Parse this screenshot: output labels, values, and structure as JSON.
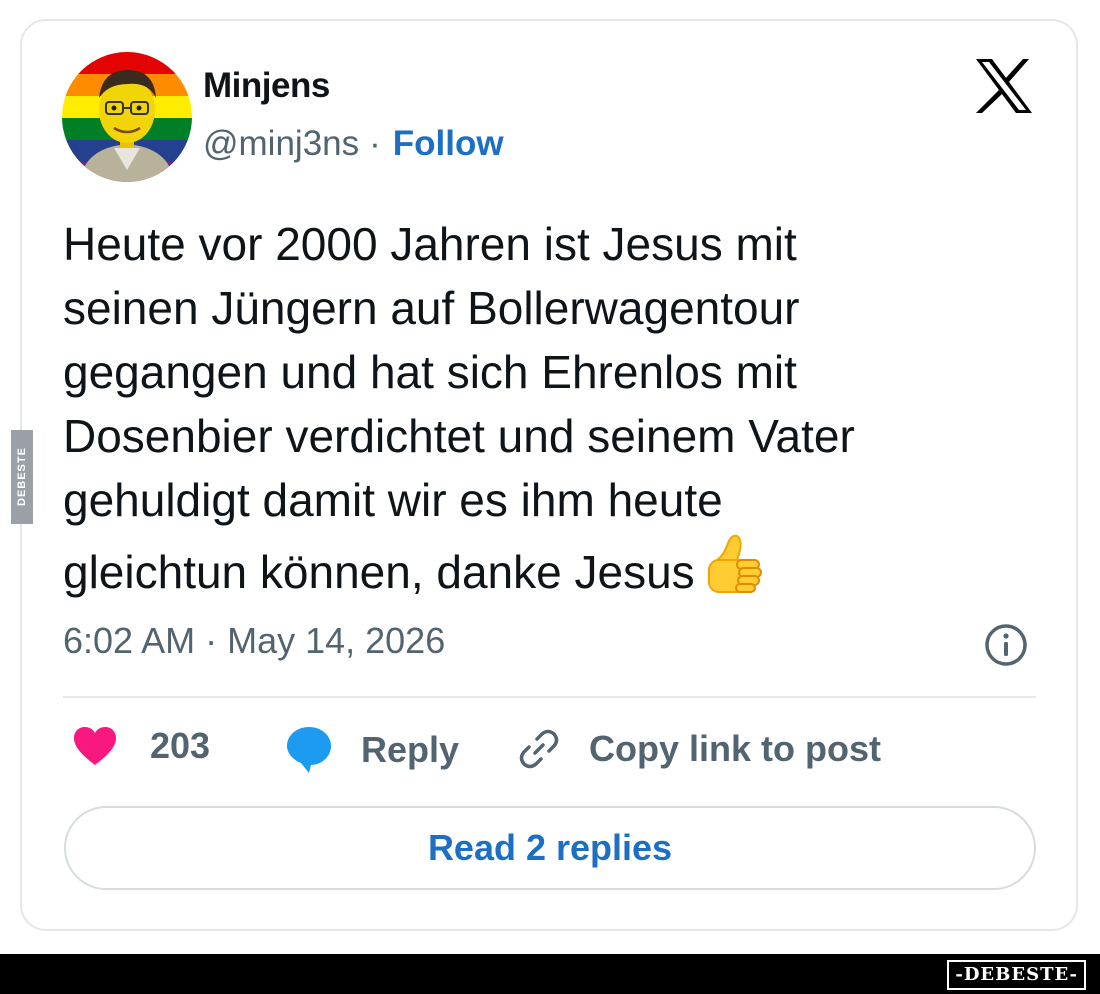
{
  "author": {
    "display_name": "Minjens",
    "handle": "@minj3ns",
    "separator": "·",
    "follow_label": "Follow"
  },
  "platform": {
    "logo_icon": "x-logo-icon"
  },
  "tweet": {
    "lines": [
      "Heute vor 2000 Jahren ist Jesus mit",
      "seinen Jüngern auf Bollerwagentour",
      "gegangen und hat sich Ehrenlos mit",
      "Dosenbier verdichtet und seinem Vater",
      "gehuldigt damit wir es ihm heute",
      "gleichtun können, danke Jesus"
    ],
    "emoji_icon": "thumbs-up-icon",
    "timestamp": "6:02 AM · May 14, 2026"
  },
  "actions": {
    "like_count": "203",
    "reply_label": "Reply",
    "copy_label": "Copy link to post"
  },
  "read_replies_label": "Read 2 replies",
  "watermark": {
    "side": "DEBESTE",
    "footer": "-DEBESTE-"
  },
  "colors": {
    "link_blue": "#1d6fc4",
    "like_pink": "#f91880",
    "reply_blue": "#1d9bf0",
    "muted_gray": "#536471"
  }
}
